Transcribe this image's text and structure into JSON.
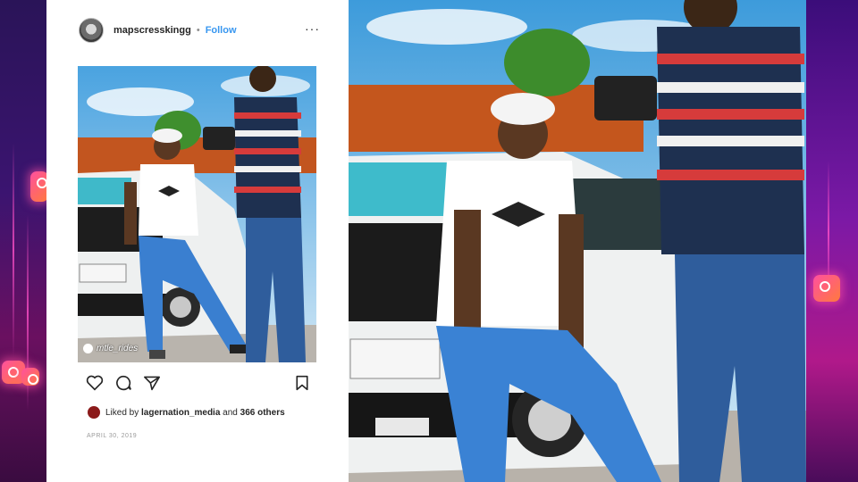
{
  "post": {
    "username": "mapscresskingg",
    "separator": "•",
    "follow_label": "Follow",
    "more_label": "···",
    "photo_watermark": "mtle_rides",
    "liked_by_prefix": "Liked by",
    "liked_by_user": "lagernation_media",
    "liked_by_joiner": "and",
    "liked_by_others": "366 others",
    "date": "APRIL 30, 2019"
  },
  "icons": {
    "like": "heart-icon",
    "comment": "comment-icon",
    "share": "send-icon",
    "save": "bookmark-icon",
    "brand": "instagram-icon"
  },
  "colors": {
    "link_blue": "#3897f0",
    "bg_purple": "#3b1470",
    "bg_magenta": "#b0198a"
  }
}
